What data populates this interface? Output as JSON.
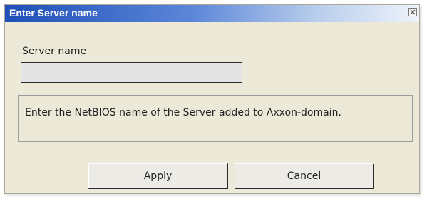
{
  "window": {
    "title": "Enter Server name",
    "close_label": "Close"
  },
  "form": {
    "server_name_label": "Server name",
    "server_name_value": "",
    "server_name_placeholder": ""
  },
  "info": {
    "text": "Enter the NetBIOS name of the Server added to Axxon-domain."
  },
  "buttons": {
    "apply_label": "Apply",
    "cancel_label": "Cancel"
  },
  "icons": {
    "close": "close-icon"
  },
  "colors": {
    "titlebar_start": "#1f4fb8",
    "titlebar_end": "#eef3fb",
    "dialog_background": "#ece9d8",
    "input_background": "#e4e4e4"
  }
}
